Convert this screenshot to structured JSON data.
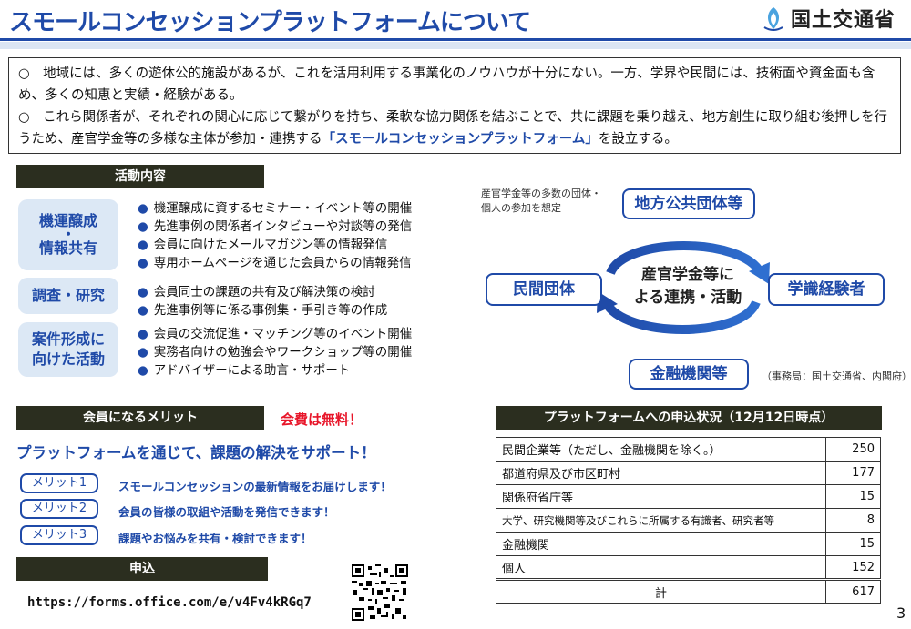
{
  "header": {
    "title": "スモールコンセッションプラットフォームについて",
    "logo_text": "国土交通省"
  },
  "intro": {
    "p1": "○　地域には、多くの遊休公的施設があるが、これを活用利用する事業化のノウハウが十分にない。一方、学界や民間には、技術面や資金面も含め、多くの知恵と実績・経験がある。",
    "p2_before": "○　これら関係者が、それぞれの関心に応じて繋がりを持ち、柔軟な協力関係を結ぶことで、共に課題を乗り越え、地方創生に取り組む後押しを行うため、産官学金等の多様な主体が参加・連携する",
    "p2_highlight": "「スモールコンセッションプラットフォーム」",
    "p2_after": "を設立する。"
  },
  "activities": {
    "heading": "活動内容",
    "items": [
      {
        "label_lines": [
          "機運醸成",
          "・",
          "情報共有"
        ],
        "bullets": [
          "機運醸成に資するセミナー・イベント等の開催",
          "先進事例の関係者インタビューや対談等の発信",
          "会員に向けたメールマガジン等の情報発信",
          "専用ホームページを通じた会員からの情報発信"
        ]
      },
      {
        "label_lines": [
          "調査・研究"
        ],
        "bullets": [
          "会員同士の課題の共有及び解決策の検討",
          "先進事例等に係る事例集・手引き等の作成"
        ]
      },
      {
        "label_lines": [
          "案件形成に",
          "向けた活動"
        ],
        "bullets": [
          "会員の交流促進・マッチング等のイベント開催",
          "実務者向けの勉強会やワークショップ等の開催",
          "アドバイザーによる助言・サポート"
        ]
      }
    ]
  },
  "diagram": {
    "note": "産官学金等の多数の団体・個人の参加を想定",
    "top": "地方公共団体等",
    "left": "民間団体",
    "right": "学識経験者",
    "bottom": "金融機関等",
    "center": "産官学金等に\nよる連携・活動",
    "office": "（事務局：国土交通省、内閣府）"
  },
  "merits": {
    "heading": "会員になるメリット",
    "free": "会費は無料！",
    "subtitle": "プラットフォームを通じて、課題の解決をサポート！",
    "items": [
      {
        "tag": "メリット1",
        "text": "スモールコンセッションの最新情報をお届けします！"
      },
      {
        "tag": "メリット2",
        "text": "会員の皆様の取組や活動を発信できます！"
      },
      {
        "tag": "メリット3",
        "text": "課題やお悩みを共有・検討できます！"
      }
    ]
  },
  "apply": {
    "heading": "申込",
    "url": "https://forms.office.com/e/v4Fv4kRGq7"
  },
  "status": {
    "heading": "プラットフォームへの申込状況（12月12日時点）",
    "rows": [
      {
        "label": "民間企業等（ただし、金融機関を除く。）",
        "value": "250"
      },
      {
        "label": "都道府県及び市区町村",
        "value": "177"
      },
      {
        "label": "関係府省庁等",
        "value": "15"
      },
      {
        "label": "大学、研究機関等及びこれらに所属する有識者、研究者等",
        "value": "8"
      },
      {
        "label": "金融機関",
        "value": "15"
      },
      {
        "label": "個人",
        "value": "152"
      }
    ],
    "total_label": "計",
    "total_value": "617"
  },
  "page_number": "3",
  "colors": {
    "accent": "#1f4aa8",
    "dark_bar": "#2b2e1f",
    "free_red": "#e8162a",
    "box_bg": "#dce8f5"
  }
}
